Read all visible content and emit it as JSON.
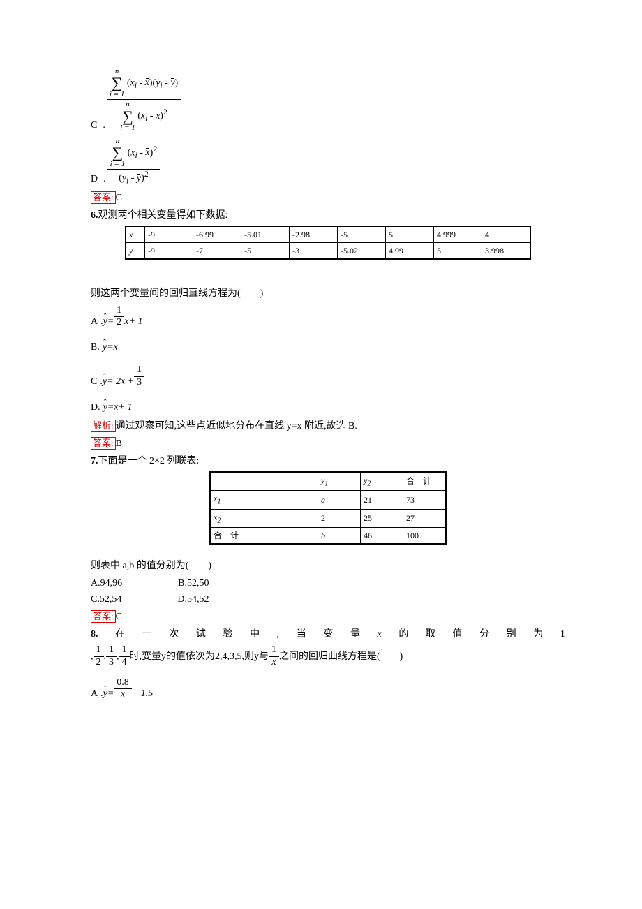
{
  "q5": {
    "C": {
      "letter": "C"
    },
    "D": {
      "letter": "D"
    },
    "answer_label": "答案:",
    "answer_value": "C"
  },
  "q6": {
    "num": "6.",
    "stem": "观测两个相关变量得如下数据:",
    "table": {
      "row_x_label": "x",
      "row_y_label": "y",
      "x": [
        "-9",
        "-6.99",
        "-5.01",
        "-2.98",
        "-5",
        "5",
        "4.999",
        "4"
      ],
      "y": [
        "-9",
        "-7",
        "-5",
        "-3",
        "-5.02",
        "4.99",
        "5",
        "3.998"
      ]
    },
    "stem2_prefix": "则这两个变量间的回归直线方程为(",
    "stem2_suffix": ")",
    "A": {
      "letter": "A",
      "prefix": ".",
      "eq_left": "y",
      "eq": " = ",
      "frac_num": "1",
      "frac_den": "2",
      "x": "x",
      "tail": " + 1"
    },
    "B": {
      "letter": "B.",
      "eq": "y = x"
    },
    "C": {
      "letter": "C",
      "prefix": ".",
      "eq_left": "y",
      "eq": " = 2x + ",
      "frac_num": "1",
      "frac_den": "3"
    },
    "D": {
      "letter": "D.",
      "eq": "y = x + 1"
    },
    "analysis_label": "解析:",
    "analysis_text": "通过观察可知,这些点近似地分布在直线 y=x 附近,故选 B.",
    "answer_label": "答案:",
    "answer_value": "B"
  },
  "q7": {
    "num": "7.",
    "stem": "下面是一个 2×2 列联表:",
    "table": {
      "h1": "",
      "h2": "y",
      "h2s": "1",
      "h3": "y",
      "h3s": "2",
      "h4": "合　计",
      "r1": [
        "x",
        "1",
        "a",
        "21",
        "73"
      ],
      "r2": [
        "x",
        "2",
        "2",
        "25",
        "27"
      ],
      "r3": [
        "合　计",
        "",
        "b",
        "46",
        "100"
      ]
    },
    "stem2": "则表中 a,b 的值分别为(　　)",
    "A": "A.94,96",
    "B": "B.52,50",
    "C": "C.52,54",
    "D": "D.54,52",
    "answer_label": "答案:",
    "answer_value": "C"
  },
  "q8": {
    "num": "8.",
    "stem_line1_chars": [
      "在",
      "一",
      "次",
      "试",
      "验",
      "中",
      ",",
      "当",
      "变",
      "量",
      "x",
      "的",
      "取",
      "值",
      "分",
      "别",
      "为",
      "1"
    ],
    "stem_line2_prefix": ",",
    "frac1_num": "1",
    "frac1_den": "2",
    "sep1": ",",
    "frac2_num": "1",
    "frac2_den": "3",
    "sep2": ",",
    "frac3_num": "1",
    "frac3_den": "4",
    "mid": "时,变量y的值依次为2,4,3,5,则y与",
    "frac4_num": "1",
    "frac4_den": "x",
    "tail": "之间的回归曲线方程是(　　)",
    "A": {
      "letter": "A",
      "prefix": ".",
      "eq_left": "y",
      "eq": " = ",
      "frac_num": "0.8",
      "frac_den": "x",
      "tail": " + 1.5"
    }
  },
  "math": {
    "n": "n",
    "i1": "i = 1",
    "xi": "x",
    "sub_i": "i",
    "yi": "y",
    "sq": "2"
  }
}
